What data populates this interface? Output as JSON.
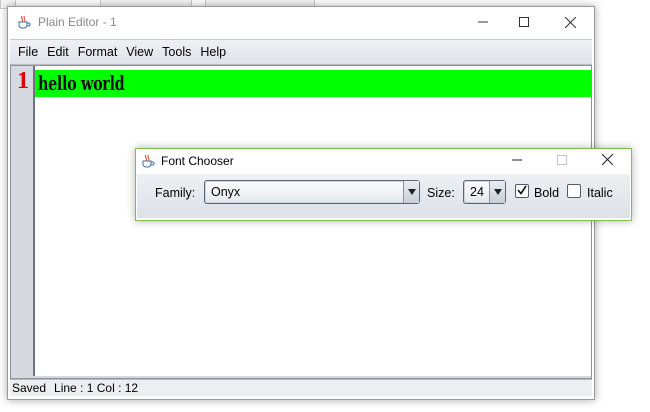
{
  "main_window": {
    "title": "Plain Editor - 1",
    "menu": [
      "File",
      "Edit",
      "Format",
      "View",
      "Tools",
      "Help"
    ],
    "editor": {
      "line_number": "1",
      "line_text": "hello world",
      "highlight_color": "#00ff00",
      "line_number_color": "#e00000"
    },
    "status": {
      "state": "Saved",
      "position": "Line : 1 Col : 12"
    }
  },
  "font_chooser": {
    "title": "Font Chooser",
    "family_label": "Family:",
    "family_value": "Onyx",
    "size_label": "Size:",
    "size_value": "24",
    "bold_label": "Bold",
    "bold_checked": true,
    "italic_label": "Italic",
    "italic_checked": false,
    "accent_color": "#7fbf4d"
  },
  "icons": {
    "app_icon": "java-coffee-cup-icon",
    "minimize": "minimize-icon",
    "maximize": "maximize-icon",
    "close": "close-icon",
    "dropdown": "chevron-down-icon",
    "checkmark": "checkmark-icon"
  }
}
